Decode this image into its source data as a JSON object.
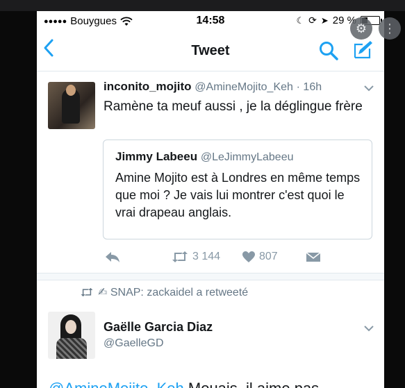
{
  "status_bar": {
    "signal_dots": "●●●●●",
    "carrier": "Bouygues",
    "time": "14:58",
    "battery": "29 %",
    "battery_level": 0.29
  },
  "nav": {
    "back_icon": "chevron-left-icon",
    "title": "Tweet",
    "search_icon": "search-icon",
    "compose_icon": "compose-icon"
  },
  "tweet": {
    "author_name": "inconito_mojito",
    "author_handle": "@AmineMojito_Keh",
    "time": "· 16h",
    "text": "Ramène ta meuf aussi ,  je la déglingue frère",
    "quoted": {
      "author_name": "Jimmy Labeeu",
      "author_handle": "@LeJimmyLabeeu",
      "text": "Amine Mojito est à Londres en même temps que moi ? Je vais lui montrer c'est quoi le vrai drapeau anglais."
    },
    "actions": {
      "reply_icon": "reply-icon",
      "retweet_count": "3 144",
      "like_count": "807",
      "dm_icon": "envelope-icon"
    }
  },
  "retweet_context": {
    "text": "✍ SNAP: zackaidel a retweeté"
  },
  "tweet2": {
    "author_name": "Gaëlle Garcia Diaz",
    "author_handle": "@GaelleGD",
    "text_start_mention": "@AmineMojito_Keh",
    "text_start": " Mouais, il aime pas"
  },
  "colors": {
    "accent": "#1da1f2",
    "secondary_text": "#657786",
    "icon_gray": "#8899a6"
  }
}
